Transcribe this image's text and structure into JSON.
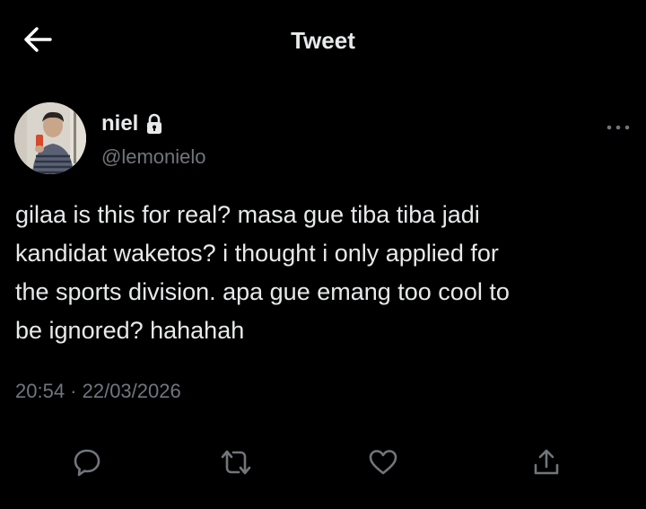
{
  "header": {
    "title": "Tweet",
    "back_icon": "arrow-left-icon"
  },
  "author": {
    "name": "niel",
    "handle": "@lemonielo",
    "protected_icon": "lock-icon",
    "more_icon": "more-horizontal-icon"
  },
  "tweet": {
    "text": "gilaa is this for real? masa gue tiba tiba jadi\nkandidat waketos? i thought i only applied for\nthe sports division. apa gue emang too cool to\nbe ignored? hahahah",
    "timestamp": "20:54 · 22/03/2026"
  },
  "actions": [
    {
      "name": "reply",
      "icon": "reply-icon"
    },
    {
      "name": "retweet",
      "icon": "retweet-icon"
    },
    {
      "name": "like",
      "icon": "heart-icon"
    },
    {
      "name": "share",
      "icon": "share-icon"
    }
  ],
  "colors": {
    "background": "#000000",
    "primary_text": "#e7e9ea",
    "secondary_text": "#71767b"
  }
}
